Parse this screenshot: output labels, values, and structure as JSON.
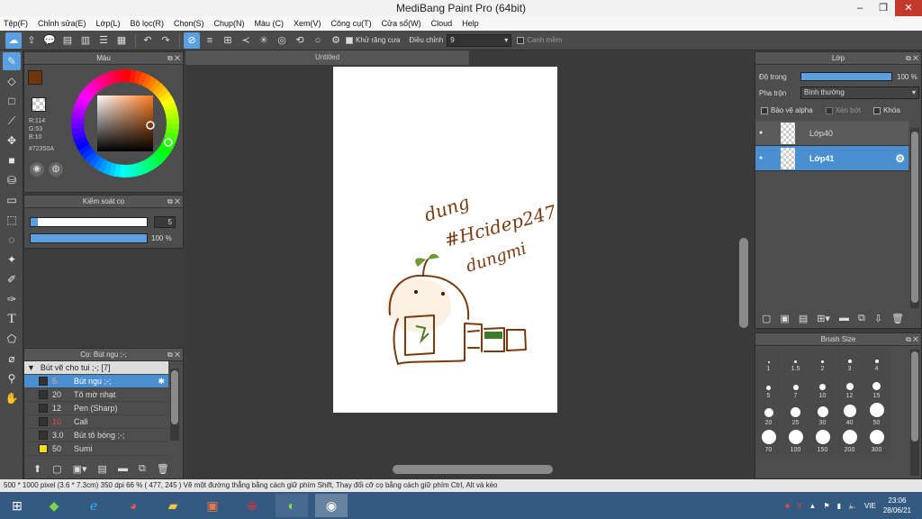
{
  "window": {
    "title": "MediBang Paint Pro (64bit)",
    "controls": [
      "–",
      "❐",
      "✕"
    ]
  },
  "menu": [
    "Tệp(F)",
    "Chỉnh sửa(E)",
    "Lớp(L)",
    "Bộ lọc(R)",
    "Chọn(S)",
    "Chụp(N)",
    "Màu (C)",
    "Xem(V)",
    "Công cụ(T)",
    "Cửa sổ(W)",
    "Cloud",
    "Help"
  ],
  "toolbar": {
    "antialias_label": "Khử răng cưa",
    "correction_label": "Điều chỉnh",
    "correction_value": "9",
    "edge_label": "Canh mềm"
  },
  "color_panel": {
    "title": "Màu",
    "r": "R:114",
    "g": "G:53",
    "b": "B:10",
    "hex": "#72350A",
    "primary_color": "#72350A",
    "hue_ring": true
  },
  "brush_control": {
    "title": "Kiểm soát cọ",
    "size_value": "5",
    "opacity_value": "100 %",
    "size_fraction": 0.02,
    "opacity_fraction": 1.0
  },
  "brush_panel": {
    "title": "Cọ: Bút ngu ;-;",
    "group": "Bút vẽ cho tui ;-; [7]",
    "items": [
      {
        "size": "5",
        "name": "Bút ngu ;-;",
        "selected": true,
        "swatch": "#333333"
      },
      {
        "size": "20",
        "name": "Tô mờ nhạt",
        "selected": false,
        "swatch": "#333333"
      },
      {
        "size": "12",
        "name": "Pen (Sharp)",
        "selected": false,
        "swatch": "#333333"
      },
      {
        "size": "10",
        "name": "Cali",
        "selected": false,
        "swatch": "#333333",
        "size_color": "#e05050"
      },
      {
        "size": "3.0",
        "name": "Bút tô bóng ;-;",
        "selected": false,
        "swatch": "#333333"
      },
      {
        "size": "50",
        "name": "Sumi",
        "selected": false,
        "swatch": "#f0e020"
      }
    ]
  },
  "canvas": {
    "tab_title": "Untitled",
    "drawing_text_1": "dung",
    "drawing_text_2": "#Hcidep247",
    "drawing_text_3": "dungmi"
  },
  "layer_panel": {
    "title": "Lớp",
    "opacity_label": "Độ trong",
    "opacity_value": "100 %",
    "blend_label": "Pha trộn",
    "blend_value": "Bình thường",
    "protect_alpha": "Bảo vệ alpha",
    "clipping": "Xén bớt",
    "lock": "Khóa",
    "layers": [
      {
        "name": "Lớp40",
        "selected": false
      },
      {
        "name": "Lớp41",
        "selected": true
      }
    ]
  },
  "brush_size_panel": {
    "title": "Brush Size",
    "sizes": [
      "1",
      "1.5",
      "2",
      "3",
      "4",
      "5",
      "7",
      "10",
      "12",
      "15",
      "20",
      "25",
      "30",
      "40",
      "50",
      "70",
      "100",
      "150",
      "200",
      "300"
    ]
  },
  "status": "500 * 1000 pixel   (3.6 * 7.3cm)   350 dpi   66 %   ( 477, 245 )   Vẽ một đường thẳng bằng cách giữ phím Shift, Thay đổi cỡ cọ bằng cách giữ phím Ctrl, Alt và kéo",
  "taskbar": {
    "lang": "VIE",
    "time": "23:06",
    "date": "28/06/21"
  }
}
